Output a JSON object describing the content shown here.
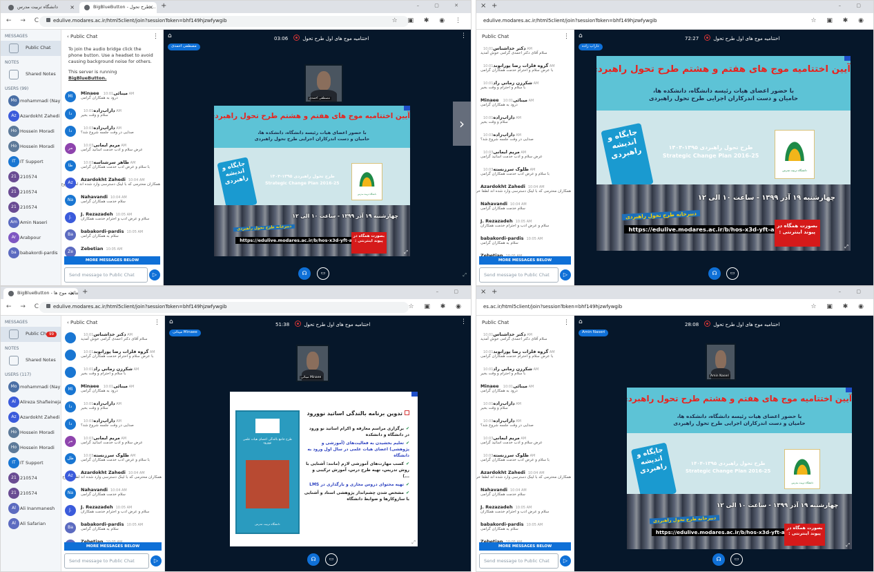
{
  "panels": [
    {
      "tabs": [
        {
          "label": "دانشگاه تربیت مدرس"
        },
        {
          "label": "BigBlueButton - اختتامیه موج های ... طرح تحول"
        }
      ],
      "url": "edulive.modares.ac.ir/html5client/join?sessionToken=bhf149hjzwfywgib",
      "sidebar": {
        "messages_header": "MESSAGES",
        "public_chat": "Public Chat",
        "notes_header": "NOTES",
        "shared_notes": "Shared Notes",
        "users_header": "USERS (99)"
      },
      "users": [
        {
          "initials": "Mo",
          "name": "mohammadi (Nay)",
          "color": "#4a6fa5"
        },
        {
          "initials": "Az",
          "name": "Azardokht Zahedi",
          "color": "#3b5bdb"
        },
        {
          "initials": "Ho",
          "name": "Hossein Moradi",
          "color": "#5d7a99"
        },
        {
          "initials": "Ho",
          "name": "Hossein Moradi",
          "color": "#5d7a99"
        },
        {
          "initials": "IT",
          "name": "IT Support",
          "color": "#1976d2"
        },
        {
          "initials": "21",
          "name": "210574",
          "color": "#6a4c93"
        },
        {
          "initials": "21",
          "name": "210574",
          "color": "#6a4c93"
        },
        {
          "initials": "21",
          "name": "210574",
          "color": "#6a4c93"
        },
        {
          "initials": "Am",
          "name": "Amin Naseri",
          "color": "#5c6bc0"
        },
        {
          "initials": "Ar",
          "name": "Arabpour",
          "color": "#7e57c2"
        },
        {
          "initials": "ba",
          "name": "babakordi-pardis",
          "color": "#5c6bc0"
        }
      ],
      "chat": {
        "title": "Public Chat",
        "welcome_1": "To join the audio bridge click the phone button. Use a headset to avoid causing background noise for others.",
        "welcome_2": "This server is running",
        "welcome_link": "BigBlueButton.",
        "messages": [
          {
            "initials": "Mi",
            "name": "Minaee مینائی",
            "time": "10:01 AM",
            "text": "درود به همکاران گرامی",
            "color": "#1976d2"
          },
          {
            "initials": "دا",
            "name": "داراب‌زاده",
            "time": "10:01 AM",
            "text": "سلام و وقت بخیر",
            "color": "#1976d2"
          },
          {
            "initials": "دا",
            "name": "داراب‌زاده",
            "time": "10:03 AM",
            "text": "صدایی در وقت جلسه شروع شد؟",
            "color": "#1976d2"
          },
          {
            "initials": "مر",
            "name": "مریم ایمانی",
            "time": "10:03 AM",
            "text": "عرض سلام و ادب خدمت اساتید گرامی",
            "color": "#8e44ad"
          },
          {
            "initials": "ظا",
            "name": "ظاهر سرشناسه",
            "time": "10:03 AM",
            "text": "با سلام و عرض ادب خدمت همکاران گرامی",
            "color": "#1976d2"
          },
          {
            "initials": "Az",
            "name": "Azardokht Zahedi",
            "time": "10:04 AM",
            "text": "همکاران محترمی که با لینک دسترسی وارد شده اند لطفا خروج",
            "color": "#3b5bdb"
          },
          {
            "initials": "Na",
            "name": "Nahavandi",
            "time": "10:04 AM",
            "text": "سلام خدمت همکاران گرامی",
            "color": "#1976d2"
          },
          {
            "initials": "J.",
            "name": "J. Rezazadeh",
            "time": "10:05 AM",
            "text": "سلام و عرض ادب و احترام خدمت همکاران",
            "color": "#3b5bdb"
          },
          {
            "initials": "Ba",
            "name": "babakordi-pardis",
            "time": "10:05 AM",
            "text": "سلام به همکاران گرامی",
            "color": "#5c6bc0"
          },
          {
            "initials": "Ze",
            "name": "Zebetian",
            "time": "10:05 AM",
            "text": "",
            "color": "#5c6bc0"
          }
        ],
        "more_messages": "MORE MESSAGES BELOW",
        "send_placeholder": "Send message to Public Chat"
      },
      "main": {
        "title": "اختتامیه موج های اول طرح تحول",
        "timer": "03:06",
        "talker": "مصطفی احمدی",
        "webcam_label": "مصطفی احمدی"
      }
    },
    {
      "tabs": [],
      "url": "edulive.modares.ac.ir/html5client/join?sessionToken=bhf149hjzwfywgib",
      "chat": {
        "title": "Public Chat",
        "messages": [
          {
            "initials": "",
            "name": "دکتر خداشناس",
            "time": "10:01 AM",
            "text": "سلام آقای دکتر احمدی گرامی خوش آمدید",
            "color": "#1976d2"
          },
          {
            "initials": "",
            "name": "گروه فلزات رضا پورانوند",
            "time": "10:01 AM",
            "text": "با عرض سلام و احترام خدمت همکاران گرامی",
            "color": "#1976d2"
          },
          {
            "initials": "",
            "name": "شکرزن زمانی راد",
            "time": "10:01 AM",
            "text": "با سلام و احترام و وقت بخیر",
            "color": "#1976d2"
          },
          {
            "initials": "",
            "name": "Minaee مینائی",
            "time": "10:01 AM",
            "text": "درود به همکاران گرامی",
            "color": "#1976d2"
          },
          {
            "initials": "",
            "name": "داراب‌زاده",
            "time": "10:01 AM",
            "text": "سلام و وقت بخیر",
            "color": "#1976d2"
          },
          {
            "initials": "",
            "name": "داراب‌زاده",
            "time": "10:03 AM",
            "text": "صدایی در وقت جلسه شروع شد؟",
            "color": "#1976d2"
          },
          {
            "initials": "",
            "name": "مریم ایمانی",
            "time": "10:03 AM",
            "text": "عرض سلام و ادب خدمت اساتید گرامی",
            "color": "#8e44ad"
          },
          {
            "initials": "",
            "name": "ظلوک سرزنسته",
            "time": "10:03 AM",
            "text": "با سلام و عرض ادب خدمت همکاران گرامی",
            "color": "#1976d2"
          },
          {
            "initials": "",
            "name": "Azardokht Zahedi",
            "time": "10:04 AM",
            "text": "همکاران محترمی که با لینک دسترسی وارد شده اند لطفا خروج",
            "color": "#3b5bdb"
          },
          {
            "initials": "",
            "name": "Nahavandi",
            "time": "10:04 AM",
            "text": "سلام خدمت همکاران گرامی",
            "color": "#1976d2"
          },
          {
            "initials": "",
            "name": "J. Rezazadeh",
            "time": "10:05 AM",
            "text": "سلام و عرض ادب و احترام خدمت همکاران",
            "color": "#3b5bdb"
          },
          {
            "initials": "",
            "name": "babakordi-pardis",
            "time": "10:05 AM",
            "text": "سلام به همکاران گرامی",
            "color": "#5c6bc0"
          },
          {
            "initials": "",
            "name": "Zebetian",
            "time": "10:05 AM",
            "text": "",
            "color": "#5c6bc0"
          }
        ],
        "more_messages": "MORE MESSAGES BELOW",
        "send_placeholder": "Send message to Public Chat"
      },
      "main": {
        "title": "اختتامیه موج های اول طرح تحول",
        "timer": "72:27",
        "talker": "داراب زاده"
      }
    },
    {
      "tabs": [
        {
          "label": "BigBlueButton - اختتامیه موج ها ..."
        }
      ],
      "url": "edulive.modares.ac.ir/html5client/join?sessionToken=bhf149hjzwfywgib",
      "sidebar": {
        "messages_header": "MESSAGES",
        "public_chat": "Public Chat",
        "badge": "99",
        "notes_header": "NOTES",
        "shared_notes": "Shared Notes",
        "users_header": "USERS (117)"
      },
      "users": [
        {
          "initials": "Mo",
          "name": "mohammadi (Nay)",
          "color": "#4a6fa5"
        },
        {
          "initials": "Al",
          "name": "Alireza Shafieinejad",
          "color": "#3b5bdb"
        },
        {
          "initials": "Az",
          "name": "Azardokht Zahedi",
          "color": "#3b5bdb"
        },
        {
          "initials": "Ho",
          "name": "Hossein Moradi",
          "color": "#5d7a99"
        },
        {
          "initials": "Ho",
          "name": "Hossein Moradi",
          "color": "#5d7a99"
        },
        {
          "initials": "IT",
          "name": "IT Support",
          "color": "#1976d2"
        },
        {
          "initials": "21",
          "name": "210574",
          "color": "#6a4c93"
        },
        {
          "initials": "21",
          "name": "210574",
          "color": "#6a4c93"
        },
        {
          "initials": "Al",
          "name": "Ali Inanmanesh",
          "color": "#5c6bc0"
        },
        {
          "initials": "Al",
          "name": "Ali Safarian",
          "color": "#5c6bc0"
        }
      ],
      "chat": {
        "title": "Public Chat",
        "messages": [
          {
            "initials": "",
            "name": "دکتر خداشناس",
            "time": "10:01 AM",
            "text": "سلام آقای دکتر احمدی گرامی خوش آمدید",
            "color": "#1976d2"
          },
          {
            "initials": "",
            "name": "گروه فلزات رضا پورانوند",
            "time": "10:01 AM",
            "text": "با عرض سلام و احترام خدمت همکاران گرامی",
            "color": "#1976d2"
          },
          {
            "initials": "",
            "name": "شکرزن زمانی راد",
            "time": "10:01 AM",
            "text": "با سلام و احترام و وقت بخیر",
            "color": "#1976d2"
          },
          {
            "initials": "Mi",
            "name": "Minaee مینائی",
            "time": "10:01 AM",
            "text": "درود به همکاران گرامی",
            "color": "#1976d2"
          },
          {
            "initials": "دا",
            "name": "داراب‌زاده",
            "time": "10:01 AM",
            "text": "سلام و وقت بخیر",
            "color": "#1976d2"
          },
          {
            "initials": "دا",
            "name": "داراب‌زاده",
            "time": "10:03 AM",
            "text": "صدایی در وقت جلسه شروع شد؟",
            "color": "#1976d2"
          },
          {
            "initials": "مر",
            "name": "مریم ایمانی",
            "time": "10:03 AM",
            "text": "عرض سلام و ادب خدمت اساتید گرامی",
            "color": "#8e44ad"
          },
          {
            "initials": "ظل",
            "name": "ظلوک سرزنسته",
            "time": "10:03 AM",
            "text": "با سلام و عرض ادب خدمت همکاران گرامی",
            "color": "#1976d2"
          },
          {
            "initials": "Az",
            "name": "Azardokht Zahedi",
            "time": "10:04 AM",
            "text": "همکاران محترمی که با لینک دسترسی وارد شده اند لطفا خروج",
            "color": "#3b5bdb"
          },
          {
            "initials": "Na",
            "name": "Nahavandi",
            "time": "10:04 AM",
            "text": "سلام خدمت همکاران گرامی",
            "color": "#1976d2"
          },
          {
            "initials": "J.",
            "name": "J. Rezazadeh",
            "time": "10:05 AM",
            "text": "سلام و عرض ادب و احترام خدمت همکاران",
            "color": "#3b5bdb"
          },
          {
            "initials": "Ba",
            "name": "babakordi-pardis",
            "time": "10:05 AM",
            "text": "سلام به همکاران گرامی",
            "color": "#5c6bc0"
          },
          {
            "initials": "Ze",
            "name": "Zebetian",
            "time": "10:05 AM",
            "text": "",
            "color": "#5c6bc0"
          }
        ],
        "more_messages": "MORE MESSAGES BELOW",
        "send_placeholder": "Send message to Public Chat"
      },
      "main": {
        "title": "اختتامیه موج های اول طرح تحول",
        "timer": "51:38",
        "talker": "مینائی Minaee",
        "webcam_label": "مینائی Minaee"
      }
    },
    {
      "tabs": [],
      "url": "es.ac.ir/html5client/join?sessionToken=bhf149hjzwfywgib",
      "chat": {
        "title": "Public Chat",
        "messages": [
          {
            "initials": "",
            "name": "دکتر خداشناس",
            "time": "10:01 AM",
            "text": "سلام آقای دکتر احمدی گرامی خوش آمدید",
            "color": "#1976d2"
          },
          {
            "initials": "",
            "name": "گروه فلزات رضا پورانوند",
            "time": "10:01 AM",
            "text": "با عرض سلام و احترام خدمت همکاران گرامی",
            "color": "#1976d2"
          },
          {
            "initials": "",
            "name": "شکرزن زمانی راد",
            "time": "10:01 AM",
            "text": "با سلام و احترام و وقت بخیر",
            "color": "#1976d2"
          },
          {
            "initials": "",
            "name": "Minaee مینائی",
            "time": "10:01 AM",
            "text": "درود به همکاران گرامی",
            "color": "#1976d2"
          },
          {
            "initials": "",
            "name": "داراب‌زاده",
            "time": "10:01 AM",
            "text": "سلام و وقت بخیر",
            "color": "#1976d2"
          },
          {
            "initials": "",
            "name": "داراب‌زاده",
            "time": "10:03 AM",
            "text": "صدایی در وقت جلسه شروع شد؟",
            "color": "#1976d2"
          },
          {
            "initials": "",
            "name": "مریم ایمانی",
            "time": "10:03 AM",
            "text": "عرض سلام و ادب خدمت اساتید گرامی",
            "color": "#8e44ad"
          },
          {
            "initials": "",
            "name": "ظلوک سرزنسته",
            "time": "10:03 AM",
            "text": "با سلام و عرض ادب خدمت همکاران گرامی",
            "color": "#1976d2"
          },
          {
            "initials": "",
            "name": "Azardokht Zahedi",
            "time": "10:04 AM",
            "text": "همکاران محترمی که با لینک دسترسی وارد شده اند لطفا خروج",
            "color": "#3b5bdb"
          },
          {
            "initials": "",
            "name": "Nahavandi",
            "time": "10:04 AM",
            "text": "سلام خدمت همکاران گرامی",
            "color": "#1976d2"
          },
          {
            "initials": "",
            "name": "J. Rezazadeh",
            "time": "10:05 AM",
            "text": "سلام و عرض ادب و احترام خدمت همکاران",
            "color": "#3b5bdb"
          },
          {
            "initials": "",
            "name": "babakordi-pardis",
            "time": "10:05 AM",
            "text": "سلام به همکاران گرامی",
            "color": "#5c6bc0"
          },
          {
            "initials": "",
            "name": "Zebetian",
            "time": "10:05 AM",
            "text": "",
            "color": "#5c6bc0"
          }
        ],
        "more_messages": "MORE MESSAGES BELOW",
        "send_placeholder": "Send message to Public Chat"
      },
      "main": {
        "title": "اختتامیه موج های اول طرح تحول",
        "timer": "28:08",
        "talker": "Amin Naseri",
        "webcam_label": "Amin Naseri"
      }
    }
  ],
  "slide": {
    "title": "آیین اختتامیه موج های هفتم و هشتم طرح تحول راهبردی",
    "subtitle_1": "با حضور اعضای هیات رئیسه دانشگاه، دانشکده ها،",
    "subtitle_2": "حامیان و دست اندرکاران اجرایی طرح تحول راهبردی",
    "calligraphy": "جایگاه و اندیشه راهبردی",
    "plan_fa": "طرح تحول راهبردی ۱۳۹۵-۱۴۰۴",
    "plan_en": "Strategic Change Plan 2016-25",
    "logo_text": "دانشگاه تربیت مدرس",
    "date": "چهارشنبه ۱۹ آذر ۱۳۹۹ - ساعت ۱۰ الی ۱۲",
    "secretariat": "دبیرخانه طرح تحول راهبردی",
    "url": "https://edulive.modares.ac.ir/b/hos-x3d-yft-aze",
    "red_box": "بصورت همگاه در پیوند اینترنتی :"
  },
  "slide2": {
    "title": "تدوین برنامه بالندگی اساتید نوورود",
    "items": [
      "برگزاری مراسم معارفه و اکرام اساتید نو ورود در دانشگاه و دانشکده",
      "تعلیم بخشیدن به فعالیت‌های (آموزشی و پژوهشی) اعضای هیات علمی در سال اول ورود به دانشگاه",
      "کسب مهارت‌های آموزشی لازم (مانند: آشنایی با روش تدریس، تهیه طرح درس، آموزش ترکیبی و ...)",
      "تهیه محتوای دروس مجازی و بارگذاری در LMS",
      "مشخص شدن چشم‌انداز پژوهشی استاد و آشنایی با سازوکارها و ضوابط دانشگاه"
    ],
    "book_title": "طرح جامع بالندگی اعضای هیات علمی نوورود",
    "book_sub": "دانشگاه تربیت مدرس"
  },
  "colors": {
    "accent": "#0f70d7",
    "meeting_bg": "#06172a",
    "badge": "#de2721",
    "record": "#d53535",
    "slide_title": "#e8231e"
  }
}
